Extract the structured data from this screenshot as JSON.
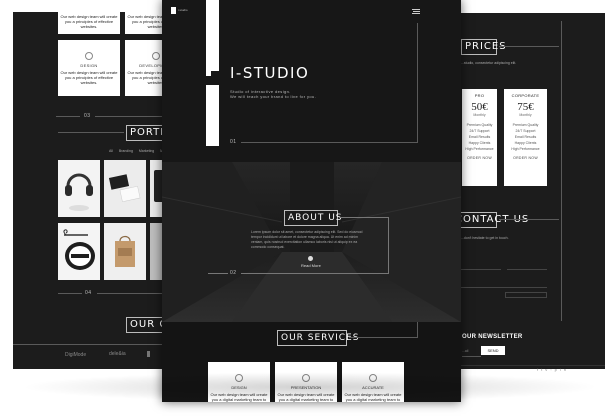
{
  "left": {
    "services_top": [
      {
        "title": "",
        "text": "Our web design team will create you a principles of effective websites."
      },
      {
        "title": "",
        "text": "Our web design team will create you a principles of effective websites."
      }
    ],
    "services": [
      {
        "title": "DESIGN",
        "text": "Our web design team will create you a principles of effective websites."
      },
      {
        "title": "DEVELOPMENT",
        "text": "Our web design team will create you a principles of effective websites."
      }
    ],
    "section_number": "03",
    "portfolio_title": "PORTFOLIO",
    "filters": [
      "All",
      "Branding",
      "Marketing",
      "Media"
    ],
    "section_number_2": "04",
    "clients_title": "OUR CLIENTS",
    "client_logos": [
      "DigiMode",
      "dele&ia"
    ]
  },
  "center": {
    "brand_small": "i.studio",
    "title": "I-STUDIO",
    "tagline": "Studio of interactive design.",
    "tagline2": "We will teach your brand to live for you.",
    "num1": "01",
    "about_title": "ABOUT US",
    "about_text": "Lorem ipsum dolor sit amet, consectetur adipiscing elit. Sed do eiusmod tempor incididunt ut labore et dolore magna aliqua. Ut enim ad minim veniam, quis nostrud exercitation ullamco laboris nisi ut aliquip ex ea commodo consequat.",
    "read_more": "Read More",
    "num2": "02",
    "services_title": "OUR SERVICES",
    "services": [
      {
        "title": "DESIGN",
        "text": "Our web design team will create you a digital marketing team to design the perfect effective websites."
      },
      {
        "title": "PRESENTATION",
        "text": "Our web design team will create you a digital marketing team to design the perfect effective websites."
      },
      {
        "title": "ACCURATE",
        "text": "Our web design team will create you a digital marketing team to design the perfect effective websites."
      }
    ]
  },
  "right": {
    "prices_title": "PRICES",
    "prices_sub": "...studio, consectetur adipiscing elit.",
    "plans": [
      {
        "name": "PRO",
        "price": "50€",
        "period": "Monthly",
        "features": [
          "Premium Quality",
          "24/7 Support",
          "Email Results",
          "Happy Clients",
          "High Performance"
        ],
        "button": "ORDER NOW"
      },
      {
        "name": "CORPORATE",
        "price": "75€",
        "period": "Monthly",
        "features": [
          "Premium Quality",
          "24/7 Support",
          "Email Results",
          "Happy Clients",
          "High Performance"
        ],
        "button": "ORDER NOW"
      }
    ],
    "contact_title": "CONTACT US",
    "contact_sub": "...don't hesitate to get in touch.",
    "newsletter_title": "OUR NEWSLETTER",
    "send": "SEND",
    "email_short": "...ail"
  }
}
